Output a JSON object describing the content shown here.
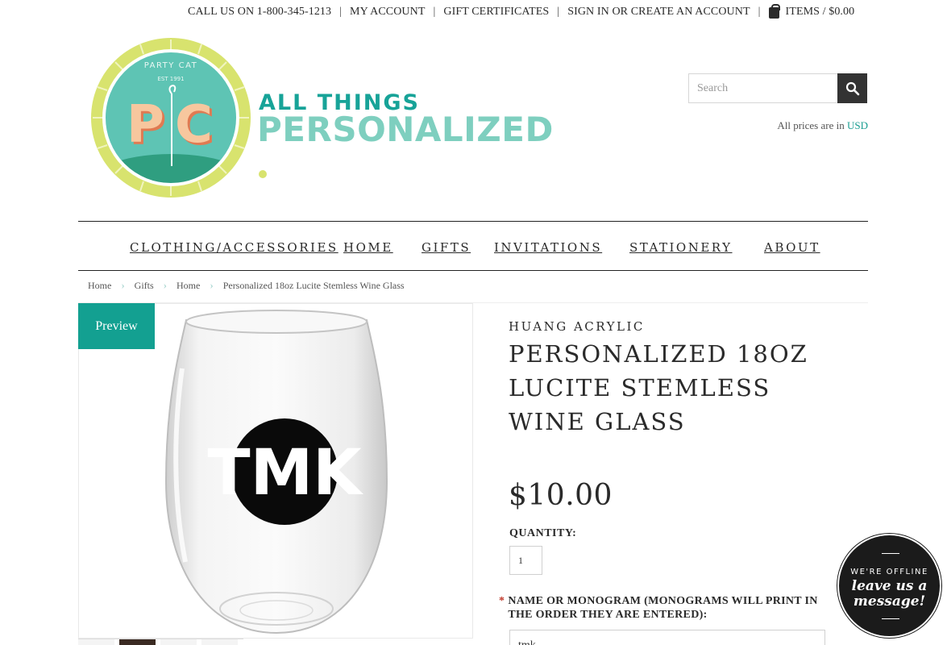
{
  "topbar": {
    "phone": "CALL US ON 1-800-345-1213",
    "my_account": "MY ACCOUNT",
    "gift_certificates": "GIFT CERTIFICATES",
    "sign_in": "SIGN IN OR CREATE AN ACCOUNT",
    "cart": "ITEMS / $0.00"
  },
  "logo": {
    "badge_text": "PARTY CAT",
    "badge_est": "EST 1991",
    "badge_letters": "PC",
    "line1": "ALL THINGS",
    "line2": "PERSONALIZED"
  },
  "search": {
    "placeholder": "Search"
  },
  "currency": {
    "label": "All prices are in",
    "code": "USD"
  },
  "nav": {
    "items": [
      "CLOTHING/ACCESSORIES",
      "HOME",
      "GIFTS",
      "INVITATIONS",
      "STATIONERY",
      "ABOUT"
    ]
  },
  "breadcrumb": {
    "items": [
      "Home",
      "Gifts",
      "Home",
      "Personalized 18oz Lucite Stemless Wine Glass"
    ]
  },
  "product": {
    "preview_label": "Preview",
    "monogram": "TMK",
    "brand": "HUANG ACRYLIC",
    "title": "PERSONALIZED 18OZ LUCITE STEMLESS WINE GLASS",
    "price": "$10.00",
    "quantity_label": "QUANTITY:",
    "quantity_value": "1",
    "required_mark": "*",
    "monogram_label": "NAME OR MONOGRAM (MONOGRAMS WILL PRINT IN THE ORDER THEY ARE ENTERED):",
    "monogram_value": "tmk"
  },
  "chat": {
    "status": "WE'RE OFFLINE",
    "message": "leave us a message!"
  },
  "colors": {
    "accent": "#13a091",
    "logo_lime": "#d8e36e",
    "logo_teal": "#5ec4b4",
    "dark": "#333333"
  }
}
